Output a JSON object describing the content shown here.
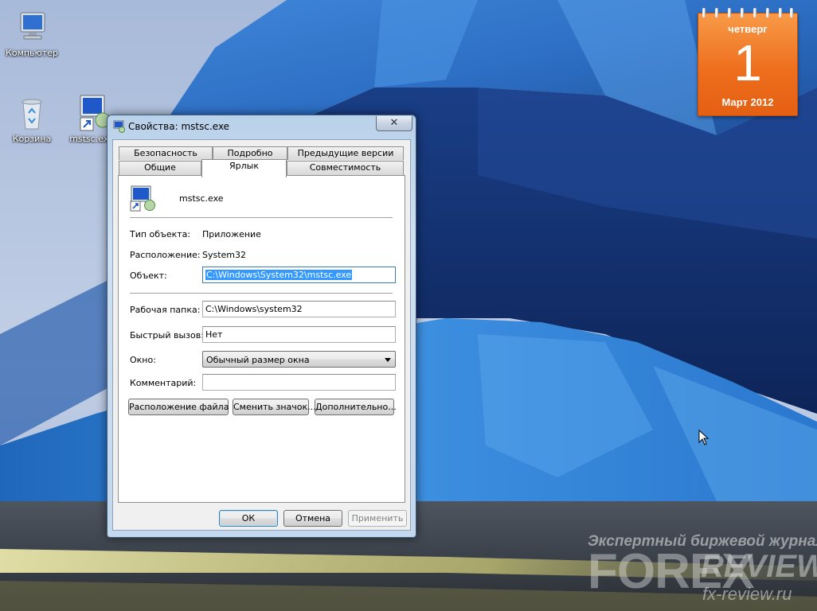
{
  "desktop": {
    "icons": [
      {
        "label": "Компьютер",
        "icon": "computer-icon"
      },
      {
        "label": "Корзина",
        "icon": "recycle-bin-icon"
      },
      {
        "label": "mstsc.exe",
        "icon": "remote-desktop-shortcut-icon"
      }
    ]
  },
  "calendar": {
    "weekday": "четверг",
    "day": "1",
    "month_year": "Март 2012",
    "color": "#ee6f1d"
  },
  "dialog": {
    "title": "Свойства: mstsc.exe",
    "close_label": "✕",
    "tabs_back": [
      "Безопасность",
      "Подробно",
      "Предыдущие версии"
    ],
    "tabs_front": [
      "Общие",
      "Ярлык",
      "Совместимость"
    ],
    "active_tab": "Ярлык",
    "file_name": "mstsc.exe",
    "fields": {
      "type_label": "Тип объекта:",
      "type_value": "Приложение",
      "location_label": "Расположение:",
      "location_value": "System32",
      "target_label": "Объект:",
      "target_value": "C:\\Windows\\System32\\mstsc.exe",
      "start_in_label": "Рабочая папка:",
      "start_in_value": "C:\\Windows\\system32",
      "hotkey_label": "Быстрый вызов:",
      "hotkey_value": "Нет",
      "run_label": "Окно:",
      "run_value": "Обычный размер окна",
      "comment_label": "Комментарий:",
      "comment_value": ""
    },
    "buttons": {
      "open_location": "Расположение файла",
      "change_icon": "Сменить значок...",
      "advanced": "Дополнительно...",
      "ok": "ОК",
      "cancel": "Отмена",
      "apply": "Применить"
    }
  },
  "watermark": {
    "line1": "Экспертный биржевой журнал",
    "brand1": "FOREX",
    "brand2": "REVIEW",
    "url": "fx-review.ru"
  }
}
